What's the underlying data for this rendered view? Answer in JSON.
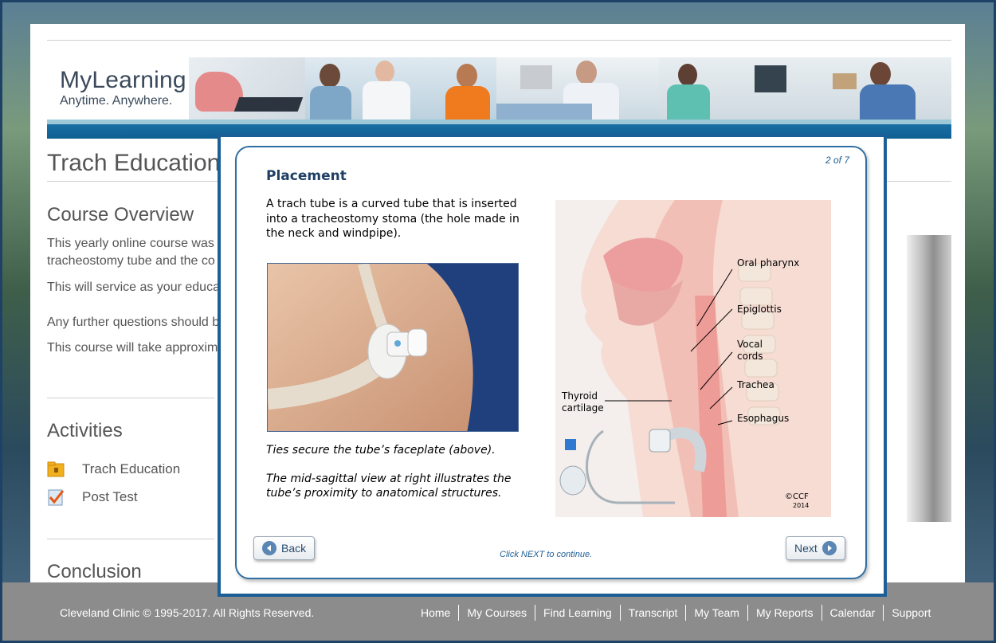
{
  "brand": {
    "title": "MyLearning",
    "subtitle": "Anytime. Anywhere."
  },
  "page": {
    "title": "Trach Education",
    "overview_heading": "Course Overview",
    "overview_lines": [
      "This yearly online course was",
      "tracheostomy tube and the co",
      "This will service as your educa",
      "Any further questions should b",
      "This course will take approxim"
    ],
    "activities_heading": "Activities",
    "activities": [
      {
        "label": "Trach Education",
        "icon": "folder-icon"
      },
      {
        "label": "Post Test",
        "icon": "checklist-icon"
      }
    ],
    "conclusion_heading": "Conclusion"
  },
  "modal": {
    "counter": "2 of 7",
    "title": "Placement",
    "intro": "A trach tube is a curved tube that is inserted into a tracheostomy stoma (the hole made in the neck and windpipe).",
    "caption1": "Ties secure the tube’s faceplate (above).",
    "caption2": "The mid-sagittal view at right illustrates the tube’s proximity to anatomical structures.",
    "labels": {
      "oral_pharynx": "Oral pharynx",
      "epiglottis": "Epiglottis",
      "vocal": "Vocal",
      "cords": "cords",
      "trachea": "Trachea",
      "esophagus": "Esophagus",
      "thyroid": "Thyroid",
      "cartilage": "cartilage",
      "ccf": "©CCF",
      "year": "2014"
    },
    "back_label": "Back",
    "next_label": "Next",
    "hint": "Click NEXT to continue."
  },
  "footer": {
    "copyright": "Cleveland Clinic © 1995-2017. All Rights Reserved.",
    "links": [
      "Home",
      "My Courses",
      "Find Learning",
      "Transcript",
      "My Team",
      "My Reports",
      "Calendar",
      "Support"
    ]
  },
  "colors": {
    "accent": "#1b5f96",
    "footer": "#8c8c8c",
    "title_blue": "#1e3f63"
  }
}
